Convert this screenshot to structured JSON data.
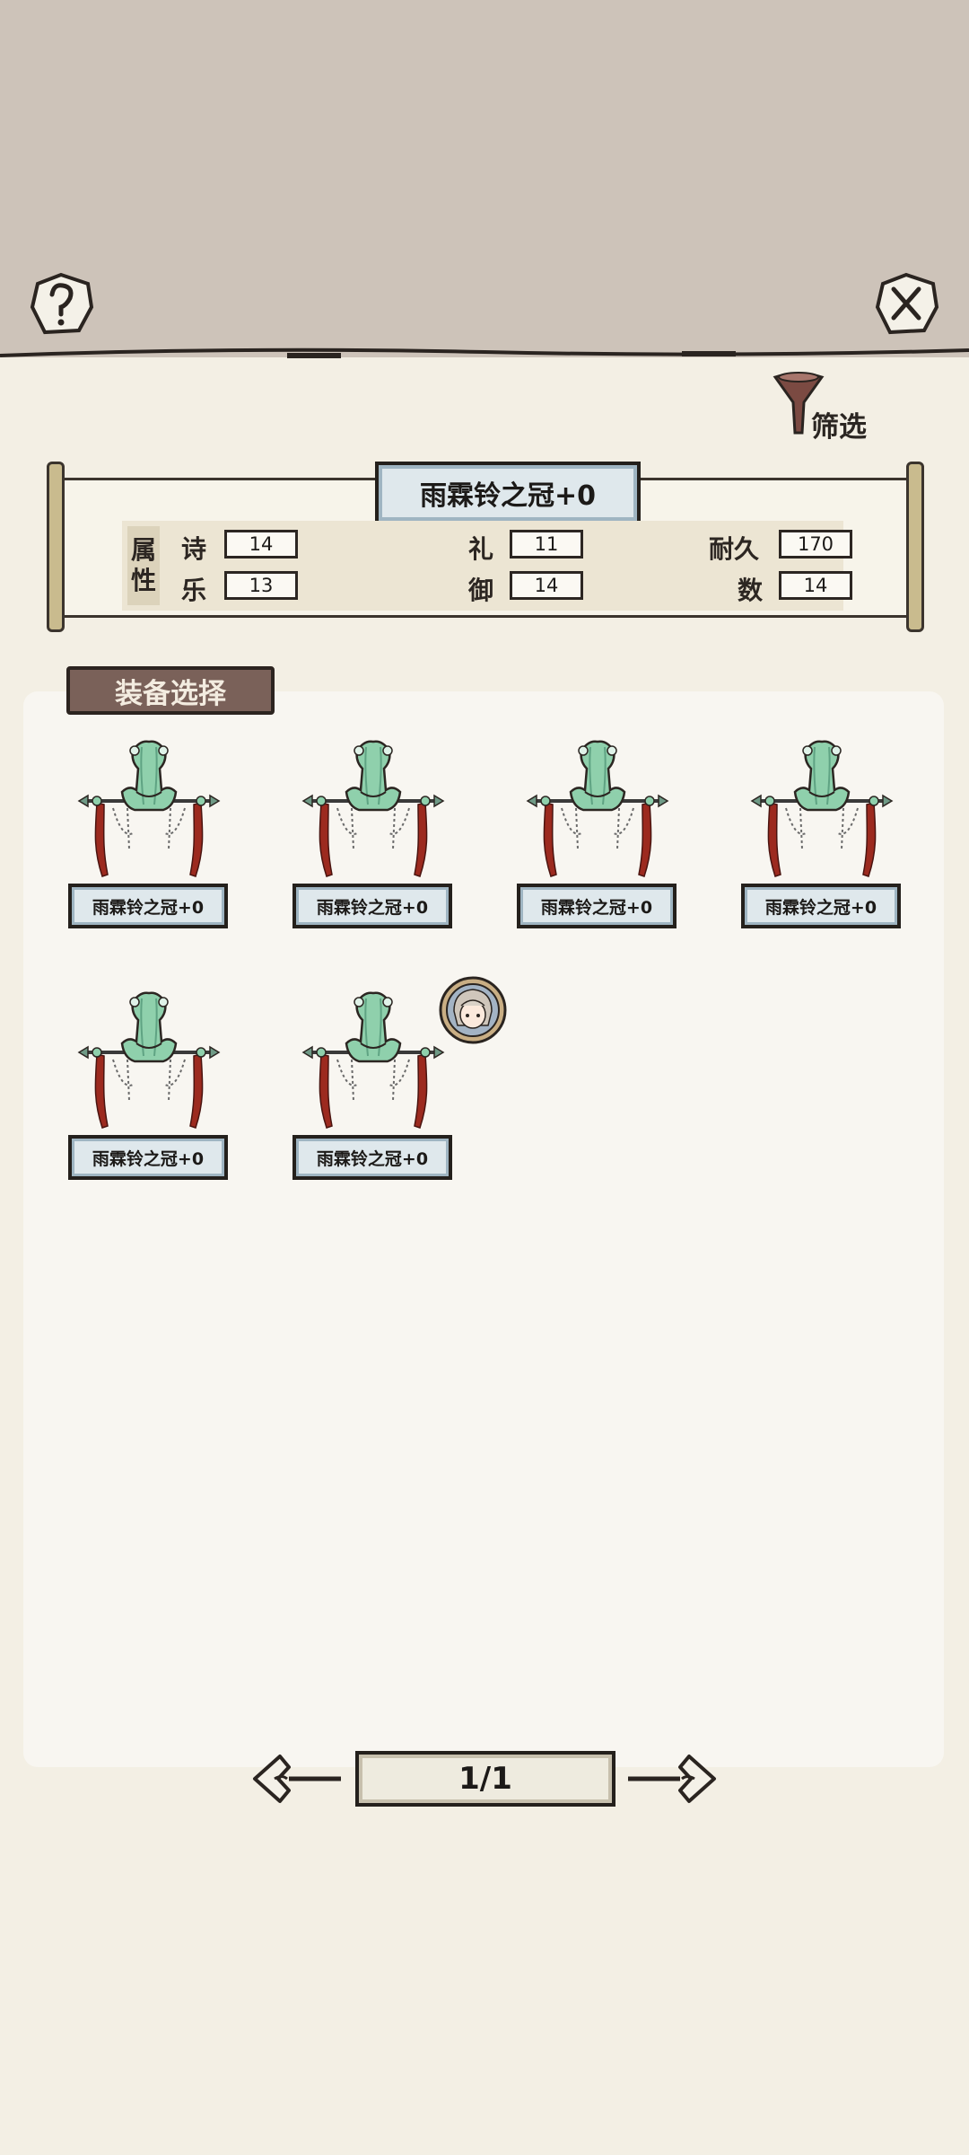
{
  "header": {
    "help_icon": "question-mark-icon",
    "close_icon": "close-x-icon"
  },
  "filter": {
    "label": "筛选",
    "icon": "funnel-icon"
  },
  "selected": {
    "title": "雨霖铃之冠+0",
    "attr_header": [
      "属",
      "性"
    ],
    "stats": [
      {
        "label": "诗",
        "value": "14"
      },
      {
        "label": "礼",
        "value": "11"
      },
      {
        "label": "耐久",
        "value": "170"
      },
      {
        "label": "乐",
        "value": "13"
      },
      {
        "label": "御",
        "value": "14"
      },
      {
        "label": "数",
        "value": "14"
      }
    ]
  },
  "section": {
    "title": "装备选择"
  },
  "items": [
    {
      "name": "雨霖铃之冠+0",
      "icon": "jade-crown-icon"
    },
    {
      "name": "雨霖铃之冠+0",
      "icon": "jade-crown-icon"
    },
    {
      "name": "雨霖铃之冠+0",
      "icon": "jade-crown-icon"
    },
    {
      "name": "雨霖铃之冠+0",
      "icon": "jade-crown-icon"
    },
    {
      "name": "雨霖铃之冠+0",
      "icon": "jade-crown-icon"
    },
    {
      "name": "雨霖铃之冠+0",
      "icon": "jade-crown-icon",
      "equipped_badge": "character-avatar-badge"
    }
  ],
  "pager": {
    "label": "1/1",
    "prev_icon": "arrow-left-icon",
    "next_icon": "arrow-right-icon"
  },
  "colors": {
    "top_band": "#cdc3b9",
    "background": "#f3efe4",
    "panel": "#f8f6f1",
    "name_plate": "#dfe8ec",
    "tab": "#7a6159",
    "jade": "#8fd0ac",
    "tassel": "#9c2a1f"
  }
}
